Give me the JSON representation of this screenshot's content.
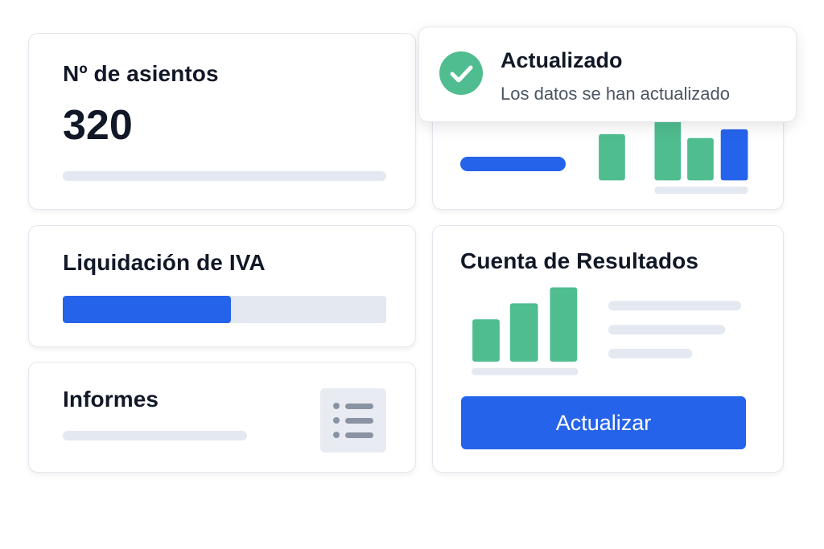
{
  "colors": {
    "accent": "#2563eb",
    "success": "#4fbd8f",
    "placeholder": "#e4e8f0",
    "text": "#111827",
    "muted": "#4b5563"
  },
  "cards": {
    "asientos": {
      "title": "Nº de asientos",
      "value": "320"
    },
    "iva": {
      "title": "Liquidación de IVA",
      "progress": 0.52
    },
    "informes": {
      "title": "Informes",
      "icon": "list-icon"
    },
    "resultados": {
      "title": "Cuenta de Resultados",
      "button_label": "Actualizar"
    }
  },
  "toast": {
    "icon": "check-circle-icon",
    "title": "Actualizado",
    "message": "Los datos se han actualizado"
  }
}
